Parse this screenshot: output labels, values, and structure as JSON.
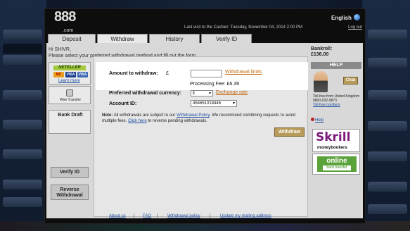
{
  "header": {
    "logo": "888",
    "logo_domain": ".com",
    "language": "English",
    "last_visit": "Last visit to the Cashier: Tuesday, November 04, 2014 2:00 PM",
    "logout": "Log out"
  },
  "tabs": [
    {
      "label": "Deposit"
    },
    {
      "label": "Withdraw"
    },
    {
      "label": "History"
    },
    {
      "label": "Verify ID"
    }
  ],
  "greeting": {
    "line1": "Hi SHIVR,",
    "line2": "Please select your preferred withdrawal method and fill out the form"
  },
  "methods": {
    "neteller": "NETELLER",
    "cards": [
      "MC",
      "VISA",
      "VISA"
    ],
    "learn_more": "Learn more",
    "wire_transfer": "Wire Transfer",
    "bank_draft": "Bank Draft"
  },
  "side_buttons": {
    "verify_id": "Verify ID",
    "reverse_line1": "Reverse",
    "reverse_line2": "Withdrawal"
  },
  "form": {
    "amount_label": "Amount to withdraw:",
    "currency_symbol": "£",
    "amount_value": "",
    "withdrawal_limits": "Withdrawal limits",
    "processing_fee": "Processing Fee: £6.39",
    "currency_label": "Preferred withdrawal currency:",
    "currency_value": "£",
    "exchange_rate": "Exchange rate",
    "account_label": "Account ID:",
    "account_value": "454651018446",
    "note_prefix": "Note:",
    "note_text": "All withdrawals are subject to our",
    "note_link": "Withdrawal Policy",
    "note_text2": ". We recommend combining requests to avoid multiple fees.",
    "note_click": "Click here",
    "note_text3": "to reverse pending withdrawals.",
    "withdraw_button": "Withdraw"
  },
  "right_panel": {
    "bankroll_label": "Bankroll:",
    "bankroll_value": "£136.00",
    "help": "HELP",
    "chat": "Chat",
    "tollfree_text": "Toll-free from United Kingdom",
    "tollfree_number": "0800-032-9873",
    "tollfree_link": "Toll-free numbers",
    "help_link": "Help",
    "skrill": "Skrill",
    "moneybookers": "moneybookers",
    "online": "online",
    "bank_transfer": "bank transfer"
  },
  "footer": {
    "links": [
      "About us",
      "FAQ",
      "Withdrawal policy",
      "Update my mailing address"
    ],
    "separator": "|"
  }
}
